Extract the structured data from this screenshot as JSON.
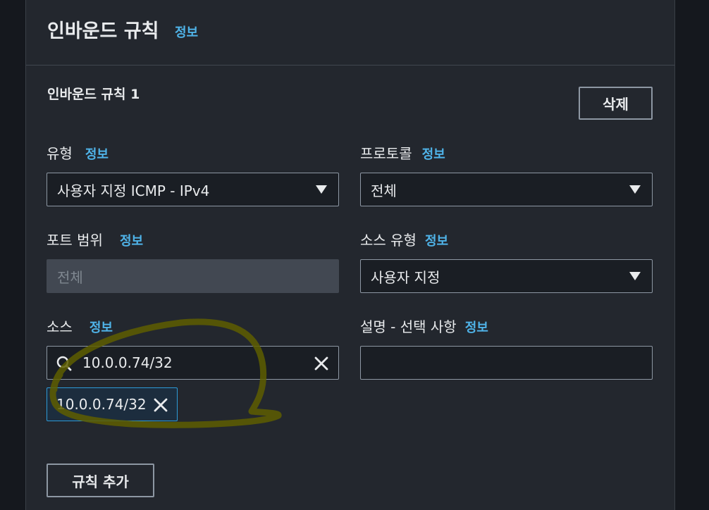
{
  "header": {
    "title": "인바운드 규칙",
    "info": "정보"
  },
  "rule": {
    "title": "인바운드 규칙 1",
    "delete_label": "삭제",
    "type": {
      "label": "유형",
      "info": "정보",
      "value": "사용자 지정 ICMP - IPv4"
    },
    "protocol": {
      "label": "프로토콜",
      "info": "정보",
      "value": "전체"
    },
    "port_range": {
      "label": "포트 범위",
      "info": "정보",
      "placeholder": "전체"
    },
    "source_type": {
      "label": "소스 유형",
      "info": "정보",
      "value": "사용자 지정"
    },
    "source": {
      "label": "소스",
      "info": "정보",
      "value": "10.0.0.74/32",
      "token": "10.0.0.74/32"
    },
    "description": {
      "label": "설명 - 선택 사항",
      "info": "정보",
      "value": ""
    }
  },
  "add_rule_label": "규칙 추가",
  "colors": {
    "info_link": "#4fb3e8",
    "annotation": "#5e5e00",
    "token_border": "#2d9bd8"
  },
  "icons": [
    "search-icon",
    "clear-icon",
    "caret-down-icon",
    "close-icon"
  ]
}
